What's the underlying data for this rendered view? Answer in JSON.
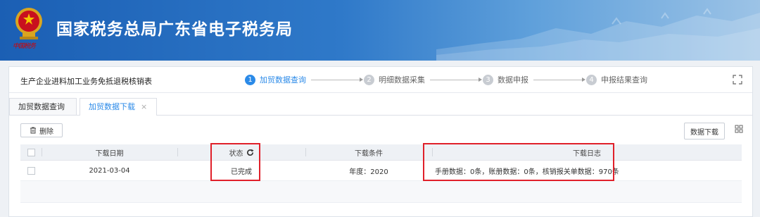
{
  "header": {
    "title": "国家税务总局广东省电子税务局",
    "emblem_caption": "中国税务",
    "colors": {
      "banner_start": "#1b5fb4",
      "banner_end": "#9cc3e6"
    }
  },
  "form": {
    "title": "生产企业进料加工业务免抵退税核销表"
  },
  "steps": [
    {
      "num": "1",
      "label": "加贸数据查询",
      "active": true
    },
    {
      "num": "2",
      "label": "明细数据采集",
      "active": false
    },
    {
      "num": "3",
      "label": "数据申报",
      "active": false
    },
    {
      "num": "4",
      "label": "申报结果查询",
      "active": false
    }
  ],
  "tabs": [
    {
      "label": "加贸数据查询"
    },
    {
      "label": "加贸数据下载",
      "close": "×"
    }
  ],
  "toolbar": {
    "delete_label": "删除",
    "download_label": "数据下载"
  },
  "table": {
    "columns": [
      "下载日期",
      "状态",
      "下载条件",
      "下载日志"
    ],
    "rows": [
      {
        "date": "2021-03-04",
        "status": "已完成",
        "condition": "年度：2020",
        "log": "手册数据：0条，账册数据：0条，核销报关单数据：970条"
      }
    ]
  },
  "accent_color": "#2b8ae8",
  "highlight_color": "#e0202a"
}
